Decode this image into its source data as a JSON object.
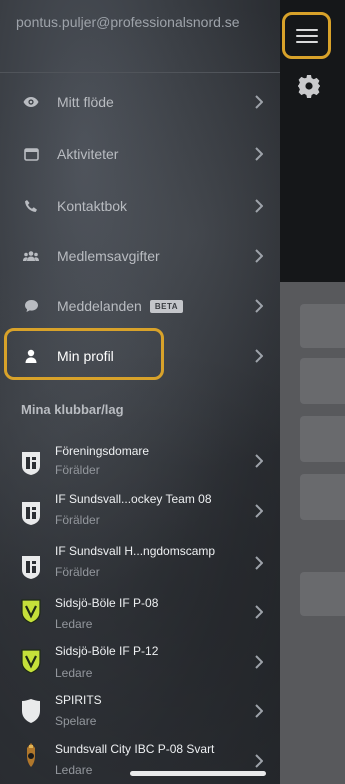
{
  "account": {
    "email": "pontus.puljer@professionalsnord.se"
  },
  "menu": [
    {
      "label": "Mitt flöde",
      "icon": "eye-icon"
    },
    {
      "label": "Aktiviteter",
      "icon": "calendar-icon"
    },
    {
      "label": "Kontaktbok",
      "icon": "phone-icon"
    },
    {
      "label": "Medlemsavgifter",
      "icon": "group-icon"
    },
    {
      "label": "Meddelanden",
      "icon": "chat-bubble-icon",
      "badge": "BETA"
    },
    {
      "label": "Min profil",
      "icon": "person-icon"
    }
  ],
  "clubs_section": {
    "title": "Mina klubbar/lag"
  },
  "clubs": [
    {
      "name": "Föreningsdomare",
      "role": "Förälder",
      "logo": "if-sundsvall-logo"
    },
    {
      "name": "IF Sundsvall...ockey Team 08",
      "role": "Förälder",
      "logo": "if-sundsvall-logo"
    },
    {
      "name": "IF Sundsvall H...ngdomscamp",
      "role": "Förälder",
      "logo": "if-sundsvall-logo"
    },
    {
      "name": "Sidsjö-Böle IF P-08",
      "role": "Ledare",
      "logo": "sidsjo-bole-shield-logo"
    },
    {
      "name": "Sidsjö-Böle IF P-12",
      "role": "Ledare",
      "logo": "sidsjo-bole-shield-logo"
    },
    {
      "name": "SPIRITS",
      "role": "Spelare",
      "logo": "white-shield-logo"
    },
    {
      "name": "Sundsvall City IBC P-08 Svart",
      "role": "Ledare",
      "logo": "sundsvall-city-logo"
    }
  ],
  "colors": {
    "highlight": "#d8a22a",
    "drawer": "#33373c",
    "accent_green": "#c5e03a"
  }
}
